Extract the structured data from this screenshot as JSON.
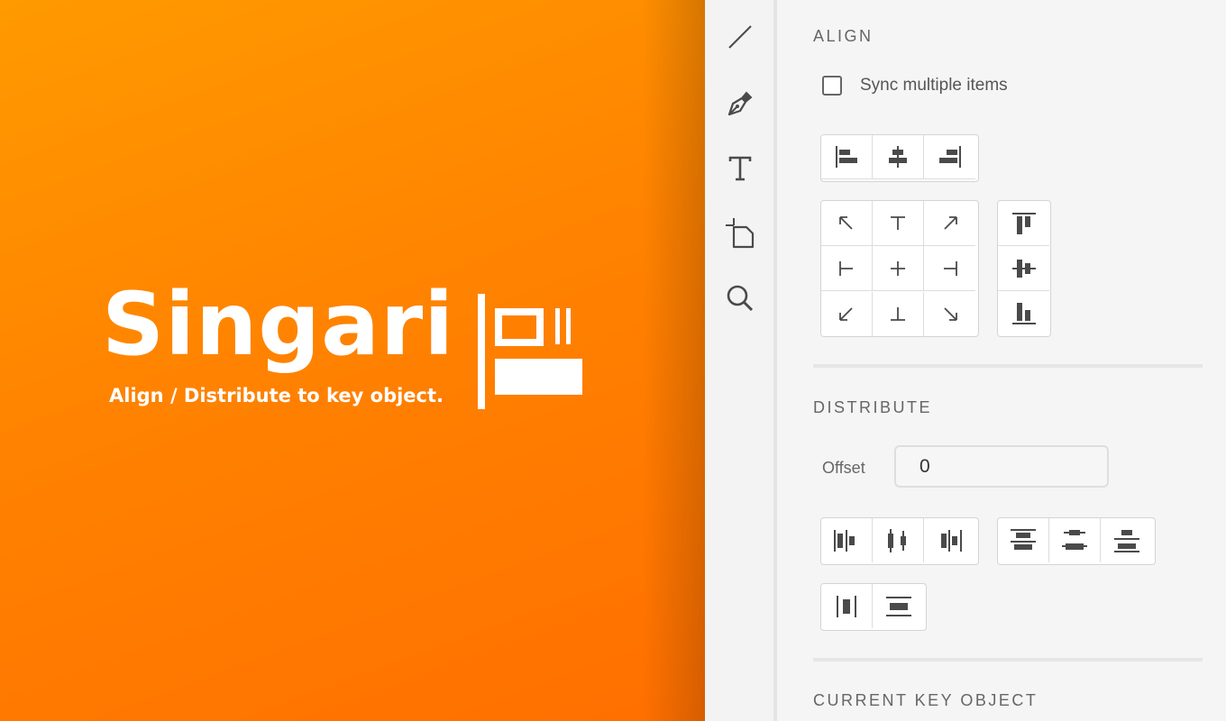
{
  "hero": {
    "title": "Singari",
    "subtitle": "Align / Distribute to key object.",
    "colors": {
      "gradient_start": "#ff9a00",
      "gradient_end": "#ff6f00"
    }
  },
  "toolbar": {
    "tools": [
      "line-tool-icon",
      "pen-tool-icon",
      "text-tool-icon",
      "artboard-tool-icon",
      "zoom-tool-icon"
    ]
  },
  "align": {
    "title": "ALIGN",
    "sync_label": "Sync multiple items",
    "sync_checked": false
  },
  "distribute": {
    "title": "DISTRIBUTE",
    "offset_label": "Offset",
    "offset_value": "0"
  },
  "key_object": {
    "title": "CURRENT KEY OBJECT"
  },
  "colors": {
    "icon": "#4a4a4a",
    "panel_bg": "#f5f5f5",
    "accent": "#ff8300"
  }
}
